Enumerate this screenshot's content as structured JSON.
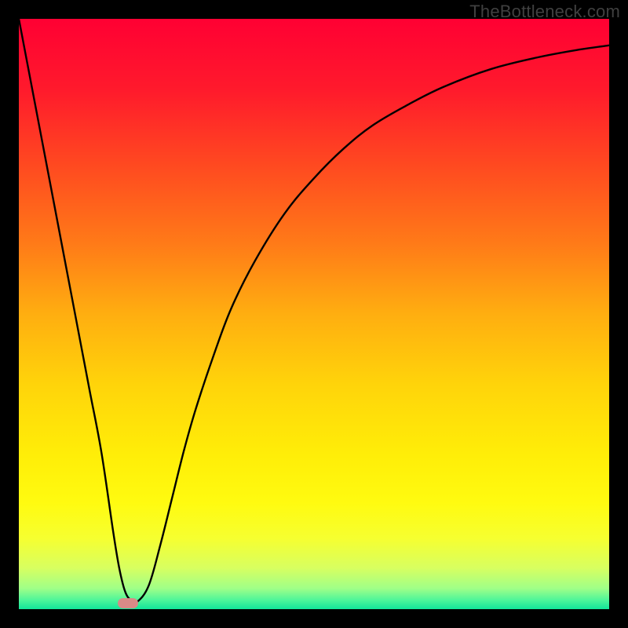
{
  "watermark": "TheBottleneck.com",
  "colors": {
    "frame": "#000000",
    "curve": "#000000",
    "marker": "#d98a87",
    "gradient_stops": [
      {
        "offset": 0.0,
        "color": "#ff0033"
      },
      {
        "offset": 0.12,
        "color": "#ff1a2c"
      },
      {
        "offset": 0.25,
        "color": "#ff4a20"
      },
      {
        "offset": 0.38,
        "color": "#ff7a18"
      },
      {
        "offset": 0.5,
        "color": "#ffae10"
      },
      {
        "offset": 0.62,
        "color": "#ffd40a"
      },
      {
        "offset": 0.74,
        "color": "#ffee08"
      },
      {
        "offset": 0.82,
        "color": "#fffb10"
      },
      {
        "offset": 0.88,
        "color": "#f6ff30"
      },
      {
        "offset": 0.93,
        "color": "#d8ff60"
      },
      {
        "offset": 0.965,
        "color": "#9fff88"
      },
      {
        "offset": 0.985,
        "color": "#4cf59a"
      },
      {
        "offset": 1.0,
        "color": "#12e59a"
      }
    ]
  },
  "chart_data": {
    "type": "line",
    "title": "",
    "xlabel": "",
    "ylabel": "",
    "xlim": [
      0,
      100
    ],
    "ylim": [
      0,
      100
    ],
    "series": [
      {
        "name": "bottleneck-curve",
        "x": [
          0,
          2,
          4,
          6,
          8,
          10,
          12,
          14,
          16,
          17,
          18,
          19,
          20,
          22,
          24,
          26,
          28,
          30,
          33,
          36,
          40,
          45,
          50,
          55,
          60,
          66,
          72,
          80,
          88,
          95,
          100
        ],
        "y": [
          100,
          89.5,
          79,
          68.5,
          58,
          47.5,
          37,
          26.5,
          13,
          7,
          3,
          1.5,
          1.2,
          4,
          11,
          19,
          27,
          34,
          43,
          51,
          59,
          67,
          73,
          78,
          82,
          85.5,
          88.5,
          91.5,
          93.5,
          94.8,
          95.5
        ]
      }
    ],
    "annotations": [
      {
        "type": "marker",
        "shape": "rounded-pill",
        "x": 18.5,
        "y": 1,
        "color": "#d98a87"
      }
    ]
  }
}
